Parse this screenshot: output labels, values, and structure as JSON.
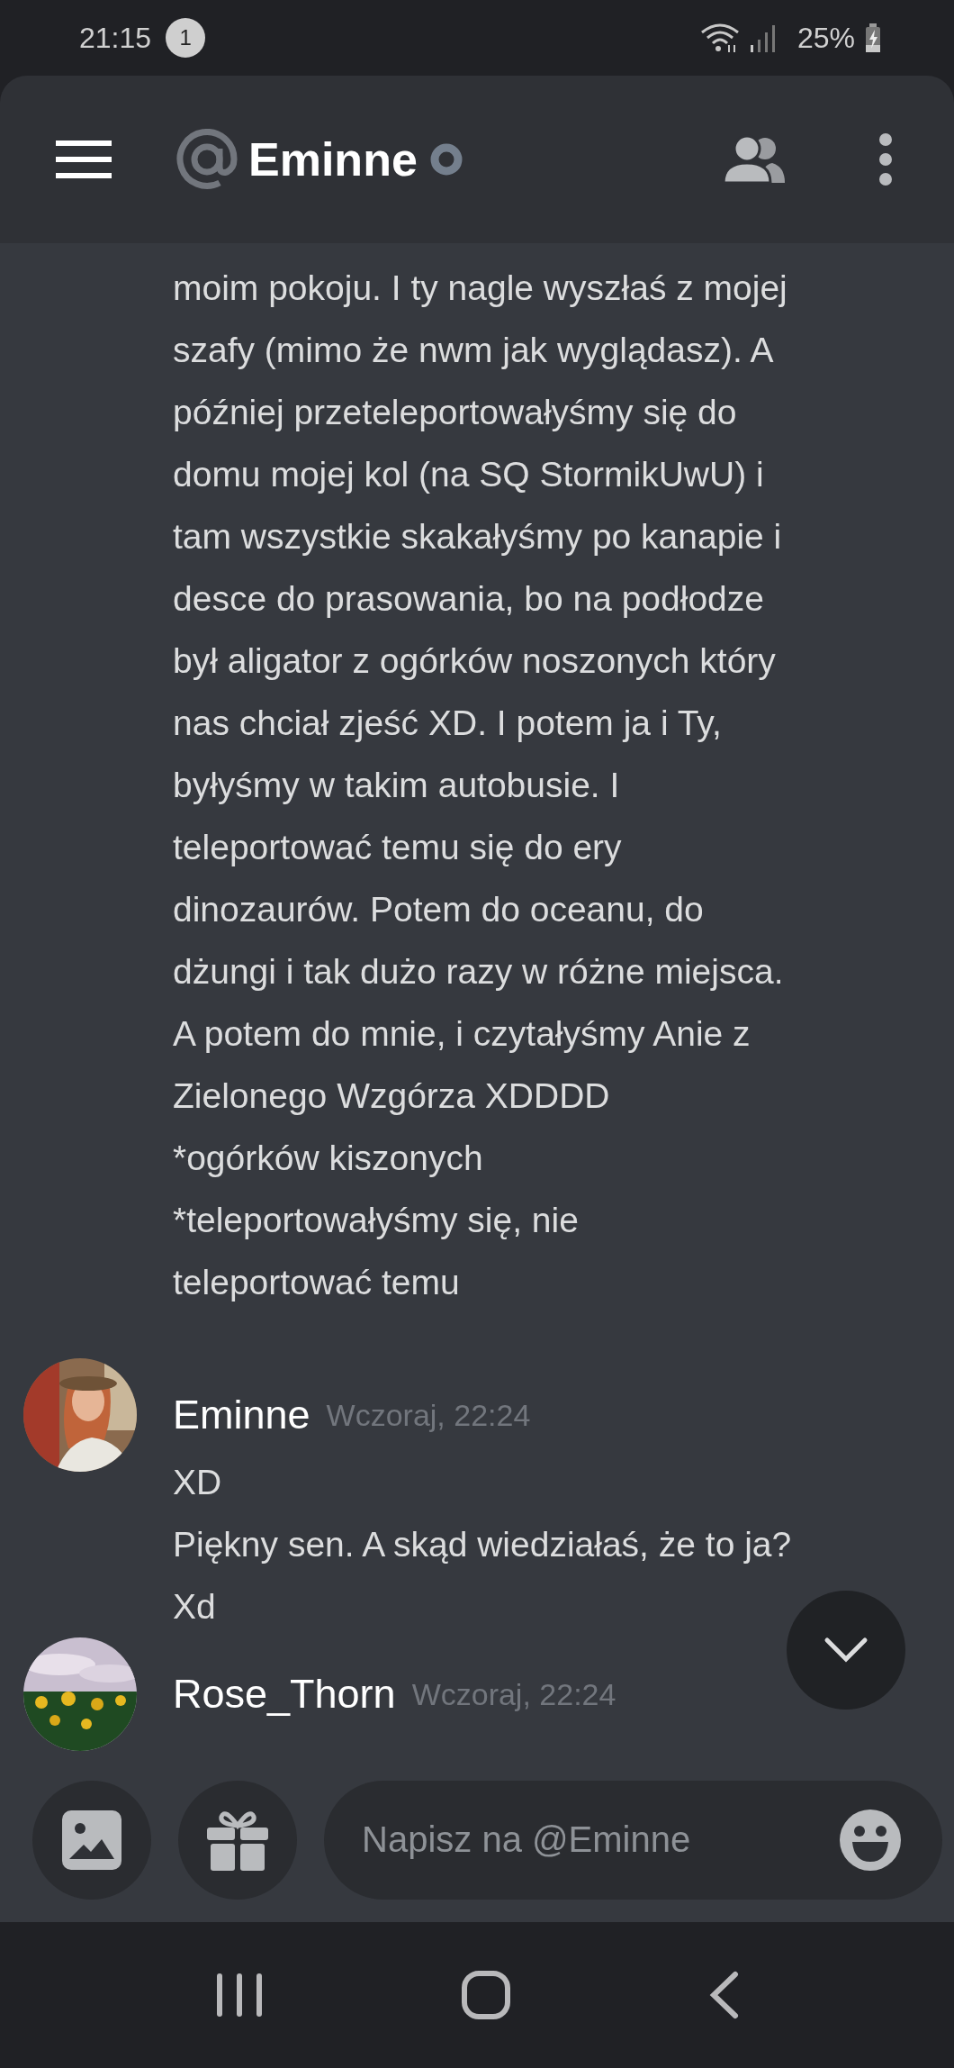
{
  "status_bar": {
    "time": "21:15",
    "notification_count": "1",
    "battery": "25%"
  },
  "header": {
    "title": "Eminne"
  },
  "messages": [
    {
      "kind": "continuation",
      "lines": [
        "moim pokoju. I ty nagle wyszłaś z mojej",
        "szafy (mimo że nwm jak wyglądasz). A",
        "później przeteleportowałyśmy się do",
        "domu mojej kol (na SQ StormikUwU) i",
        "tam wszystkie skakałyśmy po kanapie i",
        "desce do prasowania, bo na podłodze",
        "był aligator z ogórków noszonych który",
        "nas chciał zjeść XD. I potem ja i Ty,",
        "byłyśmy w takim autobusie. I",
        "teleportować temu się do ery",
        "dinozaurów. Potem do oceanu, do",
        "dżungi i tak dużo razy w różne miejsca.",
        "A potem do mnie, i czytałyśmy Anie z",
        "Zielonego Wzgórza XDDDD",
        "*ogórków kiszonych",
        "*teleportowałyśmy się, nie",
        "teleportować temu"
      ]
    },
    {
      "kind": "group",
      "author": "Eminne",
      "timestamp": "Wczoraj, 22:24",
      "lines": [
        "XD",
        "Piękny sen. A skąd wiedziałaś, że to ja?",
        "Xd"
      ]
    },
    {
      "kind": "group",
      "author": "Rose_Thorn",
      "timestamp": "Wczoraj, 22:24"
    }
  ],
  "composer": {
    "placeholder": "Napisz na @Eminne"
  }
}
